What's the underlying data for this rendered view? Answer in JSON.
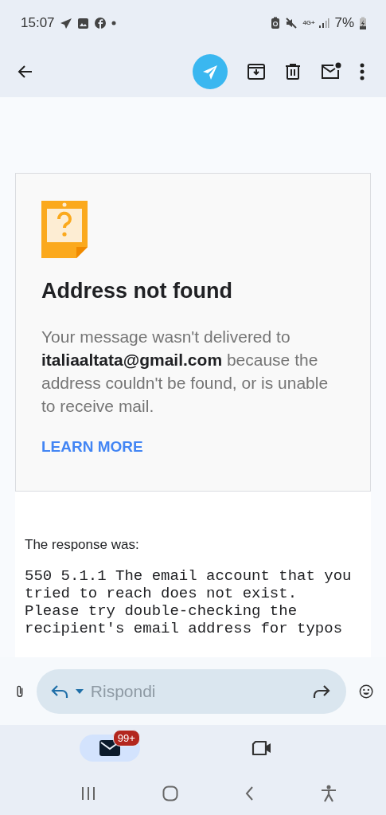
{
  "status_bar": {
    "time": "15:07",
    "network": "4G+",
    "battery": "7%"
  },
  "message": {
    "title": "Address not found",
    "body": "Your message wasn't delivered to **italiaaltata@gmail.com** because the address couldn't be found, or is unable to receive mail.",
    "link": "LEARN MORE",
    "response_label": "The response was:",
    "response_lines": [
      "550 5.1.1 The email account that you",
      "tried to reach does not exist.",
      "Please try double-checking the",
      "recipient's email address for typos"
    ]
  },
  "reply": {
    "placeholder": "Rispondi"
  },
  "bottom_tabs": [
    {
      "kind": "mail",
      "selected": true,
      "badge": "99+"
    },
    {
      "kind": "meet",
      "selected": false
    }
  ]
}
